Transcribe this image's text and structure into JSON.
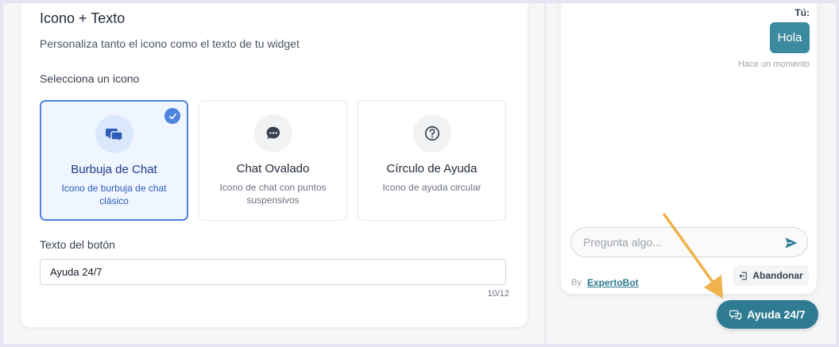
{
  "settings": {
    "title": "Icono + Texto",
    "subtitle": "Personaliza tanto el icono como el texto de tu widget",
    "select_label": "Selecciona un icono",
    "options": [
      {
        "title": "Burbuja de Chat",
        "desc": "Icono de burbuja de chat clásico",
        "icon": "chat-bubbles-icon",
        "selected": true
      },
      {
        "title": "Chat Ovalado",
        "desc": "Icono de chat con puntos suspensivos",
        "icon": "oval-chat-icon",
        "selected": false
      },
      {
        "title": "Círculo de Ayuda",
        "desc": "Icono de ayuda circular",
        "icon": "help-circle-icon",
        "selected": false
      }
    ],
    "button_text_label": "Texto del botón",
    "button_text_value": "Ayuda 24/7",
    "counter": "10/12"
  },
  "chat": {
    "you_label": "Tú:",
    "message": "Hola",
    "timestamp": "Hace un momento",
    "input_placeholder": "Pregunta algo...",
    "by_label": "By",
    "brand": "ExpertoBot",
    "abandon_label": "Abandonar"
  },
  "widget": {
    "label": "Ayuda 24/7"
  },
  "colors": {
    "accent": "#2f7c92",
    "selected_border": "#4f83e0",
    "arrow": "#f0b24a"
  }
}
